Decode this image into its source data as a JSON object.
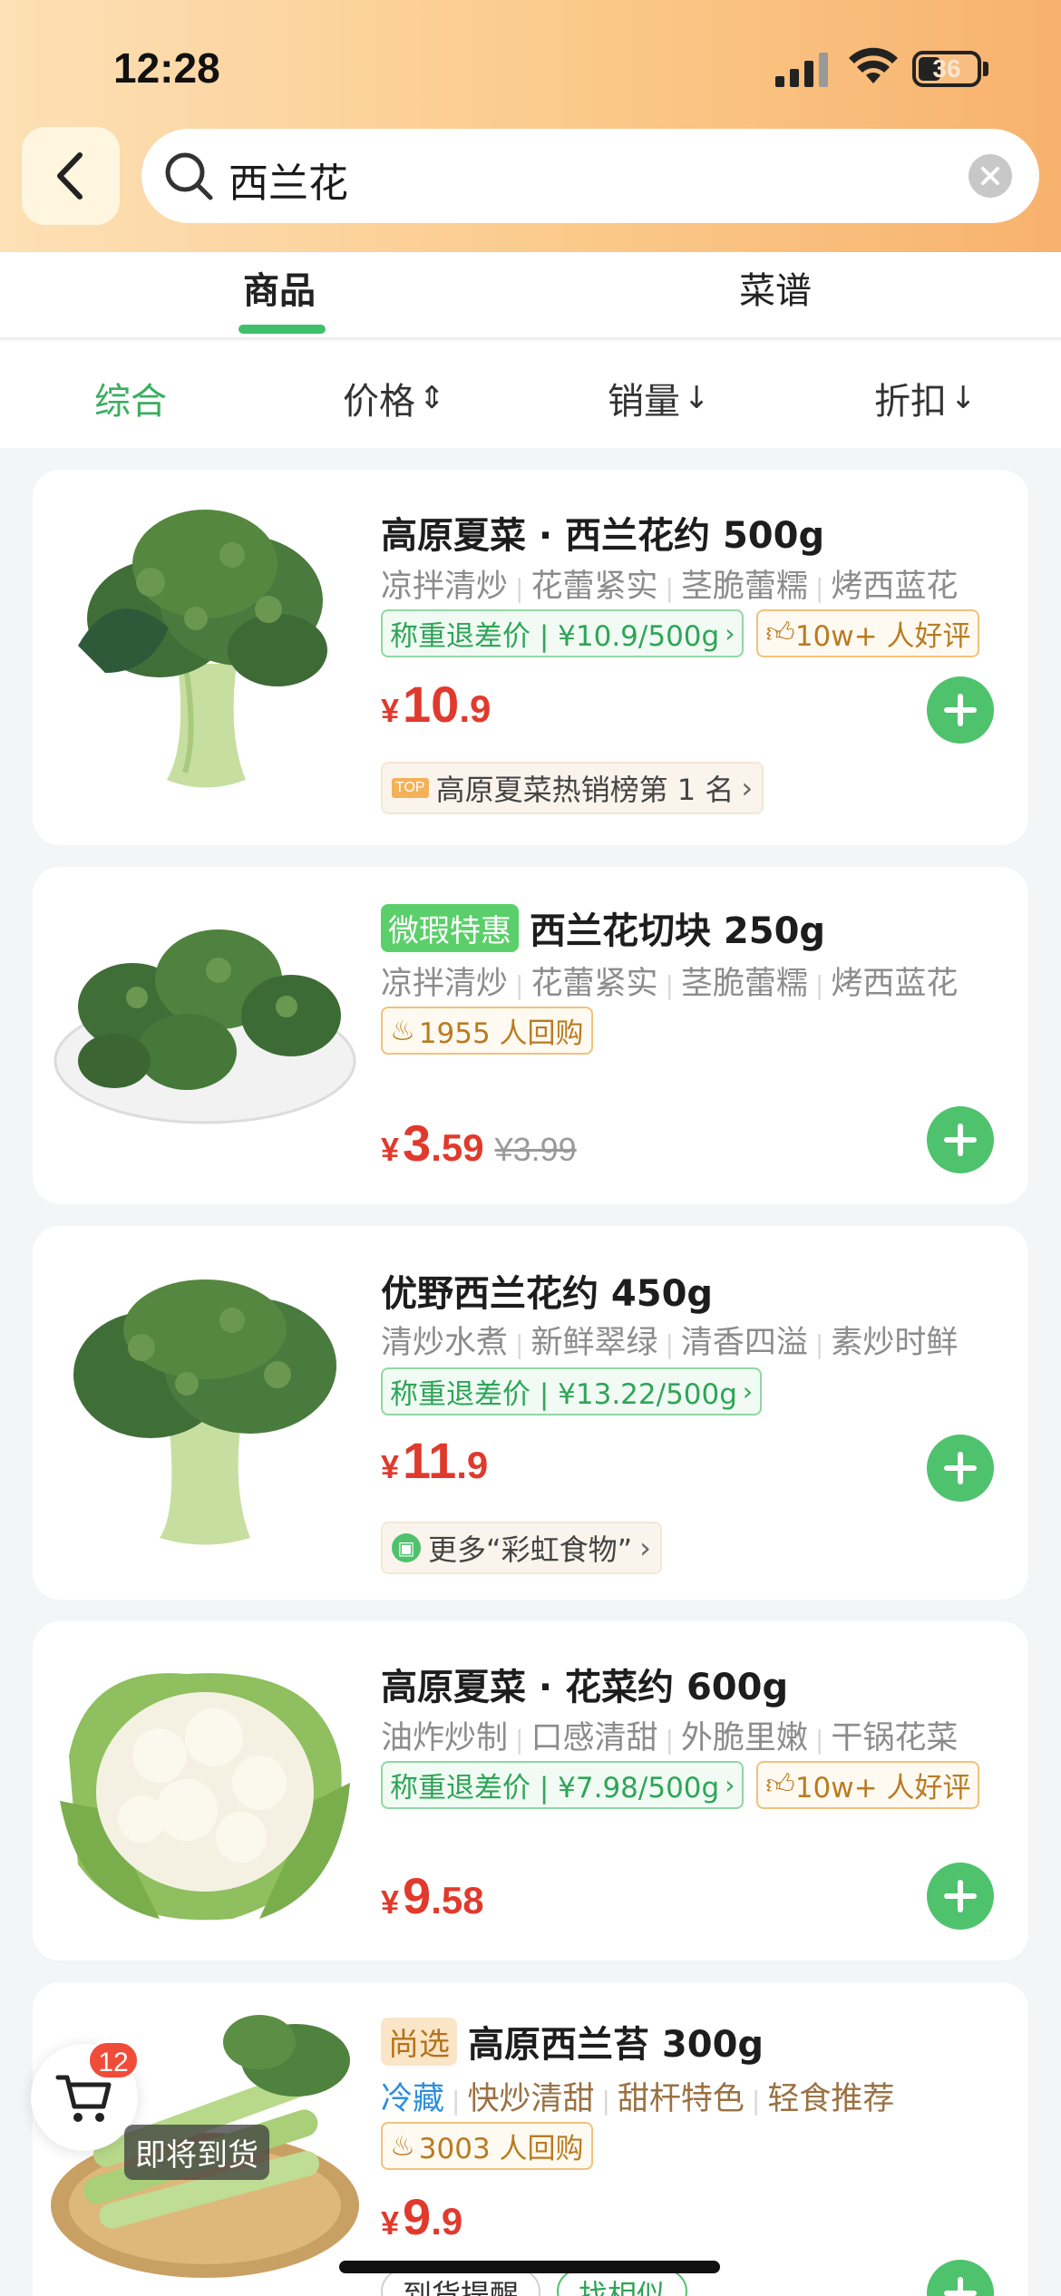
{
  "status": {
    "time": "12:28",
    "battery": "36"
  },
  "search": {
    "query": "西兰花"
  },
  "tabs": [
    {
      "label": "商品"
    },
    {
      "label": "菜谱"
    }
  ],
  "sort": [
    {
      "label": "综合"
    },
    {
      "label": "价格"
    },
    {
      "label": "销量"
    },
    {
      "label": "折扣"
    }
  ],
  "products": [
    {
      "title": "高原夏菜 · 西兰花约 500g",
      "features": [
        "凉拌清炒",
        "花蕾紧实",
        "茎脆蕾糯",
        "烤西蓝花"
      ],
      "tag_green": "称重退差价 | ¥10.9/500g",
      "tag_orange": "10w+ 人好评",
      "price_cur": "¥",
      "price_int": "10",
      "price_dec": ".9",
      "chip": "高原夏菜热销榜第 1 名"
    },
    {
      "badge": "微瑕特惠",
      "title": "西兰花切块 250g",
      "features": [
        "凉拌清炒",
        "花蕾紧实",
        "茎脆蕾糯",
        "烤西蓝花"
      ],
      "tag_orange": "1955 人回购",
      "price_cur": "¥",
      "price_int": "3",
      "price_dec": ".59",
      "price_old": "¥3.99"
    },
    {
      "title": "优野西兰花约 450g",
      "features": [
        "清炒水煮",
        "新鲜翠绿",
        "清香四溢",
        "素炒时鲜"
      ],
      "tag_green": "称重退差价 | ¥13.22/500g",
      "price_cur": "¥",
      "price_int": "11",
      "price_dec": ".9",
      "chip": "更多“彩虹食物”"
    },
    {
      "title": "高原夏菜 · 花菜约 600g",
      "features": [
        "油炸炒制",
        "口感清甜",
        "外脆里嫩",
        "干锅花菜"
      ],
      "tag_green": "称重退差价 | ¥7.98/500g",
      "tag_orange": "10w+ 人好评",
      "price_cur": "¥",
      "price_int": "9",
      "price_dec": ".58"
    },
    {
      "badge": "尚选",
      "title": "高原西兰苔 300g",
      "features": [
        "冷藏",
        "快炒清甜",
        "甜杆特色",
        "轻食推荐"
      ],
      "tag_orange": "3003 人回购",
      "price_cur": "¥",
      "price_int": "9",
      "price_dec": ".9"
    }
  ],
  "cart": {
    "count": "12",
    "overlay": "即将到货"
  },
  "bottom_buttons": {
    "notify": "到货提醒",
    "similar": "找相似"
  },
  "colors": {
    "accent_green": "#4fc26d",
    "price_red": "#e03a2d",
    "header_orange": "#fbc98a"
  }
}
